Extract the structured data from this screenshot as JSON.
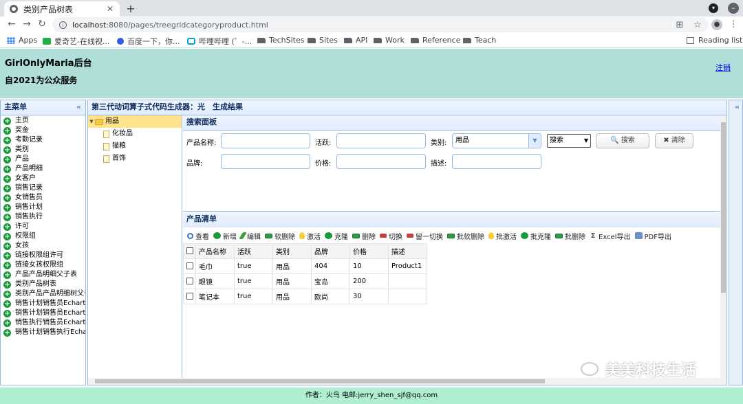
{
  "browser": {
    "tab_title": "类别产品树表",
    "new_tab": "+",
    "url_host": "localhost",
    "url_rest": ":8080/pages/treegridcategoryproduct.html",
    "bookmarks": [
      "Apps",
      "爱奇艺-在线视...",
      "百度一下，你...",
      "哔哩哔哩 (゜-...",
      "TechSites",
      "Sites",
      "API",
      "Work",
      "Reference",
      "Teach"
    ],
    "reading_list": "Reading list"
  },
  "header": {
    "title": "GirlOnlyMaria后台",
    "subtitle": "自2021为公众服务",
    "logout": "注销"
  },
  "sidebar": {
    "title": "主菜单",
    "collapse": "«",
    "items": [
      "主页",
      "奖金",
      "考勤记录",
      "类别",
      "产品",
      "产品明细",
      "女客户",
      "销售记录",
      "女销售员",
      "销售计划",
      "销售执行",
      "许可",
      "权限组",
      "女孩",
      "链接权限组许可",
      "链接女孩权限组",
      "产品产品明细父子表",
      "类别产品树表",
      "类别产品产品明细树父子",
      "销售计划销售员Echarts",
      "销售计划销售员Echarts",
      "销售执行销售员Echarts",
      "销售计划销售执行Echa"
    ]
  },
  "main": {
    "title": "第三代动词算子式代码生成器：光　生成结果",
    "tree": [
      {
        "label": "用品",
        "type": "folder",
        "selected": true
      },
      {
        "label": "化妆品",
        "type": "file"
      },
      {
        "label": "猫粮",
        "type": "file"
      },
      {
        "label": "首饰",
        "type": "file"
      }
    ],
    "search": {
      "title": "搜索面板",
      "product_name": "产品名称:",
      "active": "活跃:",
      "category": "类别:",
      "category_value": "用品",
      "select_value": "搜索",
      "search_btn": "搜索",
      "clear_btn": "清除",
      "brand": "品牌:",
      "price": "价格:",
      "desc": "描述:"
    },
    "list": {
      "title": "产品清单",
      "toolbar": [
        "查看",
        "新增",
        "编辑",
        "软删除",
        "激活",
        "克隆",
        "删除",
        "切换",
        "留一切换",
        "批软删除",
        "批激活",
        "批克隆",
        "批删除",
        "Excel导出",
        "PDF导出"
      ],
      "columns": [
        "产品名称",
        "活跃",
        "类别",
        "品牌",
        "价格",
        "描述"
      ],
      "rows": [
        [
          "毛巾",
          "true",
          "用品",
          "404",
          "10",
          "Product1"
        ],
        [
          "眼镜",
          "true",
          "用品",
          "宝岛",
          "200",
          ""
        ],
        [
          "笔记本",
          "true",
          "用品",
          "欧尚",
          "30",
          ""
        ]
      ]
    }
  },
  "watermark": "美美科技生活",
  "footer": "作者：火鸟 电邮:jerry_shen_sjf@qq.com"
}
